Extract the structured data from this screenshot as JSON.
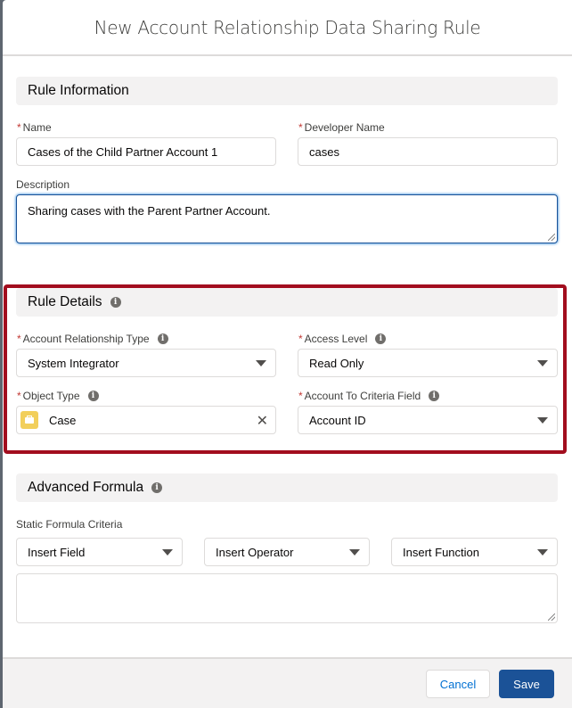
{
  "modal": {
    "title": "New Account Relationship Data Sharing Rule"
  },
  "rule_information": {
    "heading": "Rule Information",
    "name": {
      "label": "Name",
      "required": "*",
      "value": "Cases of the Child Partner Account 1"
    },
    "developer_name": {
      "label": "Developer Name",
      "required": "*",
      "value": "cases"
    },
    "description": {
      "label": "Description",
      "value": "Sharing cases with the Parent Partner Account."
    }
  },
  "rule_details": {
    "heading": "Rule Details",
    "account_relationship_type": {
      "label": "Account Relationship Type",
      "required": "*",
      "value": "System Integrator"
    },
    "access_level": {
      "label": "Access Level",
      "required": "*",
      "value": "Read Only"
    },
    "object_type": {
      "label": "Object Type",
      "required": "*",
      "value": "Case",
      "icon": "case-icon",
      "clear_glyph": "✕"
    },
    "account_to_criteria_field": {
      "label": "Account To Criteria Field",
      "required": "*",
      "value": "Account ID"
    },
    "highlight_color": "#a20d1e"
  },
  "advanced_formula": {
    "heading": "Advanced Formula",
    "static_label": "Static Formula Criteria",
    "insert_field": "Insert Field",
    "insert_operator": "Insert Operator",
    "insert_function": "Insert Function",
    "formula_value": ""
  },
  "info_glyph": "i",
  "footer": {
    "cancel_label": "Cancel",
    "save_label": "Save",
    "brand_color": "#1b5297"
  }
}
